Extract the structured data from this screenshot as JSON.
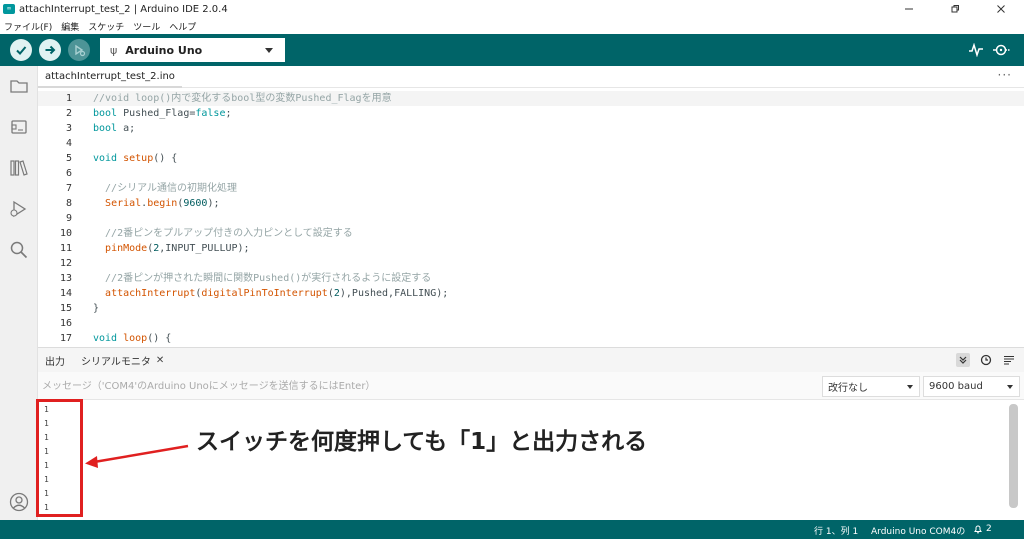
{
  "window": {
    "logo": "∞",
    "title": "attachInterrupt_test_2 | Arduino IDE 2.0.4",
    "controls": [
      "minimize-icon",
      "maximize-icon",
      "close-icon"
    ]
  },
  "menu": [
    "ファイル(F)",
    "編集",
    "スケッチ",
    "ツール",
    "ヘルプ"
  ],
  "toolbar": {
    "buttons": [
      "verify-icon",
      "upload-icon",
      "debug-icon"
    ],
    "board": "Arduino Uno",
    "usb_icon": "ψ",
    "right_icons": [
      "serial-plotter-icon",
      "serial-monitor-icon"
    ]
  },
  "sidebar": {
    "icons": [
      "folder-icon",
      "board-manager-icon",
      "library-icon",
      "debug-icon",
      "search-icon",
      "account-icon"
    ]
  },
  "editor": {
    "tab": "attachInterrupt_test_2.ino",
    "tab_more": "···",
    "lines": [
      {
        "n": "1",
        "text": "//void loop()内で変化するbool型の変数Pushed_Flagを用意"
      },
      {
        "n": "2",
        "text": "bool Pushed_Flag=false;"
      },
      {
        "n": "3",
        "text": "bool a;"
      },
      {
        "n": "4",
        "text": ""
      },
      {
        "n": "5",
        "text": "void setup() {"
      },
      {
        "n": "6",
        "text": ""
      },
      {
        "n": "7",
        "text": "  //シリアル通信の初期化処理"
      },
      {
        "n": "8",
        "text": "  Serial.begin(9600);"
      },
      {
        "n": "9",
        "text": ""
      },
      {
        "n": "10",
        "text": "  //2番ピンをプルアップ付きの入力ピンとして設定する"
      },
      {
        "n": "11",
        "text": "  pinMode(2,INPUT_PULLUP);"
      },
      {
        "n": "12",
        "text": ""
      },
      {
        "n": "13",
        "text": "  //2番ピンが押された瞬間に関数Pushed()が実行されるように設定する"
      },
      {
        "n": "14",
        "text": "  attachInterrupt(digitalPinToInterrupt(2),Pushed,FALLING);"
      },
      {
        "n": "15",
        "text": "}"
      },
      {
        "n": "16",
        "text": ""
      },
      {
        "n": "17",
        "text": "void loop() {"
      }
    ]
  },
  "output_panel": {
    "tab_output": "出力",
    "tab_serial": "シリアルモニタ",
    "close": "✕",
    "icons": [
      "autoscroll-icon",
      "timestamp-icon",
      "clear-output-icon"
    ],
    "message_placeholder": "メッセージ（'COM4'のArduino Unoにメッセージを送信するにはEnter）",
    "line_ending": "改行なし",
    "baud": "9600 baud",
    "serial_lines": [
      "1",
      "1",
      "1",
      "1",
      "1",
      "1",
      "1",
      "1"
    ]
  },
  "annotation": {
    "text": "スイッチを何度押しても「1」と出力される",
    "color": "#e02020"
  },
  "status": {
    "position": "行 1、列 1",
    "board_port": "Arduino Uno COM4の",
    "notifications": "2"
  },
  "colors": {
    "toolbar": "#006468",
    "accent": "#00979d"
  }
}
